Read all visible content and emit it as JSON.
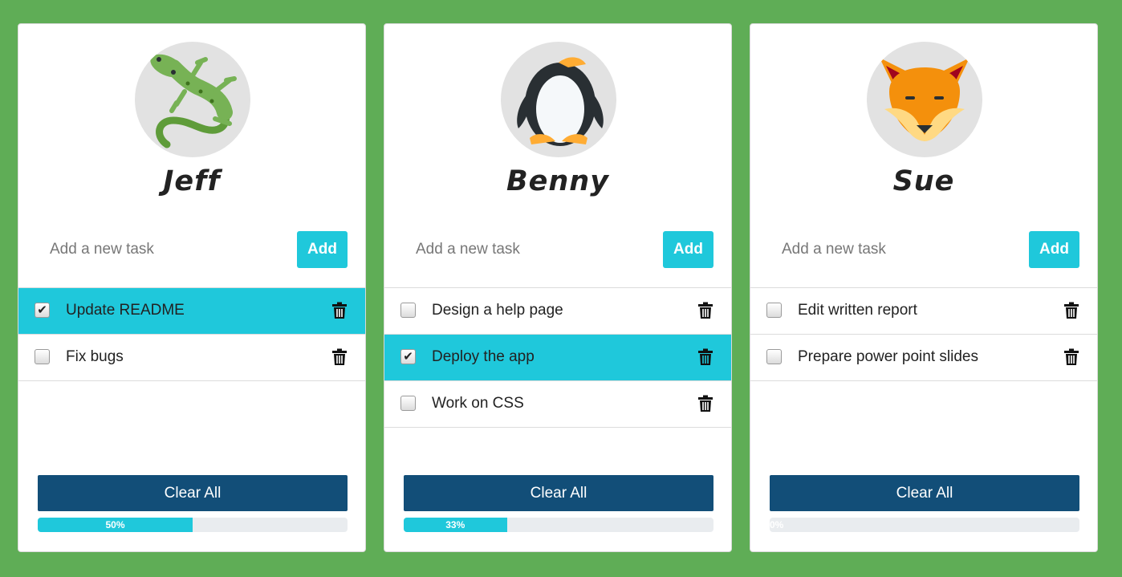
{
  "lists": [
    {
      "name": "Jeff",
      "avatar_icon": "lizard-icon",
      "placeholder": "Add a new task",
      "add_label": "Add",
      "clear_label": "Clear All",
      "progress_label": "50%",
      "progress": 0.5,
      "tasks": [
        {
          "text": "Update README",
          "done": true
        },
        {
          "text": "Fix bugs",
          "done": false
        }
      ]
    },
    {
      "name": "Benny",
      "avatar_icon": "penguin-icon",
      "placeholder": "Add a new task",
      "add_label": "Add",
      "clear_label": "Clear All",
      "progress_label": "33%",
      "progress": 0.333,
      "tasks": [
        {
          "text": "Design a help page",
          "done": false
        },
        {
          "text": "Deploy the app",
          "done": true
        },
        {
          "text": "Work on CSS",
          "done": false
        }
      ]
    },
    {
      "name": "Sue",
      "avatar_icon": "fox-icon",
      "placeholder": "Add a new task",
      "add_label": "Add",
      "clear_label": "Clear All",
      "progress_label": "0%",
      "progress": 0,
      "tasks": [
        {
          "text": "Edit written report",
          "done": false
        },
        {
          "text": "Prepare power point slides",
          "done": false
        }
      ]
    }
  ],
  "colors": {
    "background": "#5fad56",
    "accent": "#1fc8db",
    "clear_button": "#124e78"
  }
}
